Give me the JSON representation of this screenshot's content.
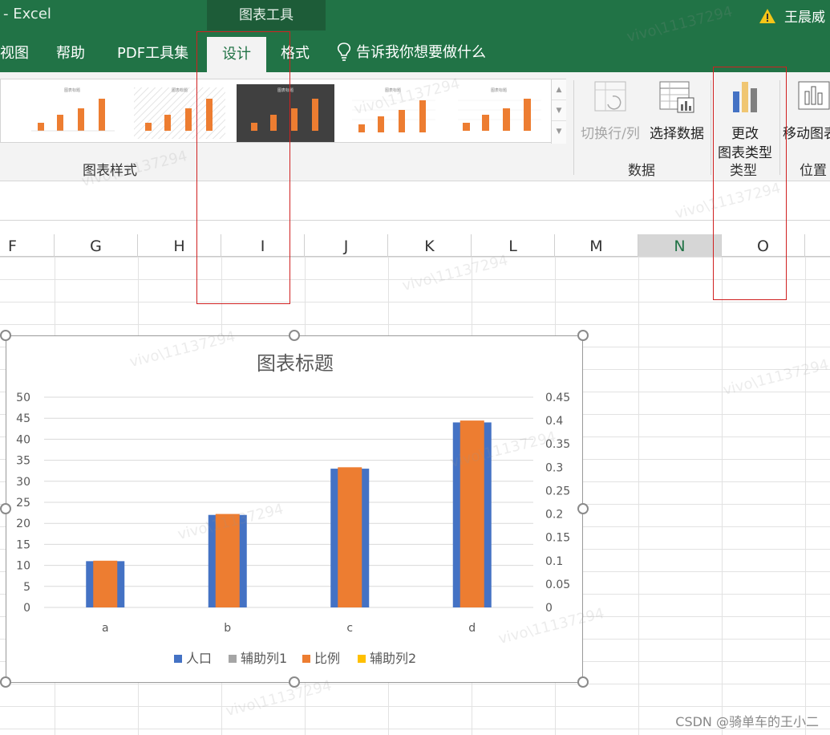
{
  "titlebar": {
    "app_title": "-  Excel",
    "tools_group": "图表工具",
    "user": "王晨威"
  },
  "tabs": [
    {
      "label": "视图"
    },
    {
      "label": "帮助"
    },
    {
      "label": "PDF工具集"
    },
    {
      "label": "设计",
      "active": true
    },
    {
      "label": "格式"
    }
  ],
  "tell_me": "告诉我你想要做什么",
  "ribbon": {
    "chart_styles_label": "图表样式",
    "switch_row_col": "切换行/列",
    "select_data": "选择数据",
    "data_group": "数据",
    "change_type_line1": "更改",
    "change_type_line2": "图表类型",
    "type_group": "类型",
    "move_chart": "移动图表",
    "position_group": "位置"
  },
  "columns": [
    "F",
    "G",
    "H",
    "I",
    "J",
    "K",
    "L",
    "M",
    "N",
    "O"
  ],
  "selected_column": "N",
  "watermark": "vivo\\11137294",
  "footer": "CSDN @骑单车的王小二",
  "chart_data": {
    "type": "bar",
    "title": "图表标题",
    "categories": [
      "a",
      "b",
      "c",
      "d"
    ],
    "series": [
      {
        "name": "人口",
        "axis": "primary",
        "values": [
          11,
          22,
          33,
          44
        ],
        "color": "#4472C4"
      },
      {
        "name": "辅助列1",
        "axis": "primary",
        "values": [
          0,
          0,
          0,
          0
        ],
        "color": "#A5A5A5"
      },
      {
        "name": "比例",
        "axis": "secondary",
        "values": [
          0.1,
          0.2,
          0.3,
          0.4
        ],
        "color": "#ED7D31"
      },
      {
        "name": "辅助列2",
        "axis": "secondary",
        "values": [
          0,
          0,
          0,
          0
        ],
        "color": "#FFC000"
      }
    ],
    "ylim": [
      0,
      50
    ],
    "yticks": [
      "0",
      "5",
      "10",
      "15",
      "20",
      "25",
      "30",
      "35",
      "40",
      "45",
      "50"
    ],
    "y2lim": [
      0,
      0.45
    ],
    "y2ticks": [
      "0",
      "0.05",
      "0.1",
      "0.15",
      "0.2",
      "0.25",
      "0.3",
      "0.35",
      "0.4",
      "0.45"
    ],
    "grid": true,
    "legend_position": "bottom"
  }
}
